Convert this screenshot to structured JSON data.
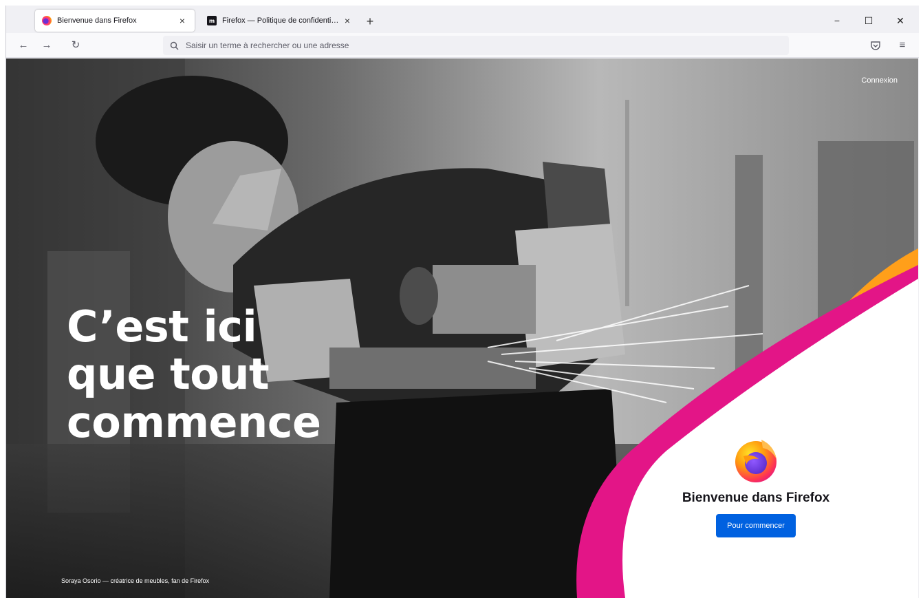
{
  "tabs": [
    {
      "title": "Bienvenue dans Firefox",
      "favicon": "firefox-icon",
      "active": true
    },
    {
      "title": "Firefox — Politique de confidentialité",
      "favicon": "mozilla-m-icon",
      "active": false
    }
  ],
  "tab_icons": {
    "close": "×",
    "new_tab": "+"
  },
  "window_controls": {
    "minimize": "−",
    "maximize": "☐",
    "close": "✕"
  },
  "navbar": {
    "back": "←",
    "forward": "→",
    "reload": "↻",
    "url_placeholder": "Saisir un terme à rechercher ou une adresse",
    "menu": "≡"
  },
  "page": {
    "signin": "Connexion",
    "headline": [
      "C’est ici",
      "que tout",
      "commence"
    ],
    "caption": "Soraya Osorio — créatrice de meubles, fan de Firefox",
    "welcome_title": "Bienvenue dans Firefox",
    "start_button": "Pour commencer"
  },
  "colors": {
    "accent_blue": "#0061e0",
    "wave_orange": "#ff9f1a",
    "wave_pink": "#e31587",
    "tab_strip": "#f0f0f4"
  }
}
